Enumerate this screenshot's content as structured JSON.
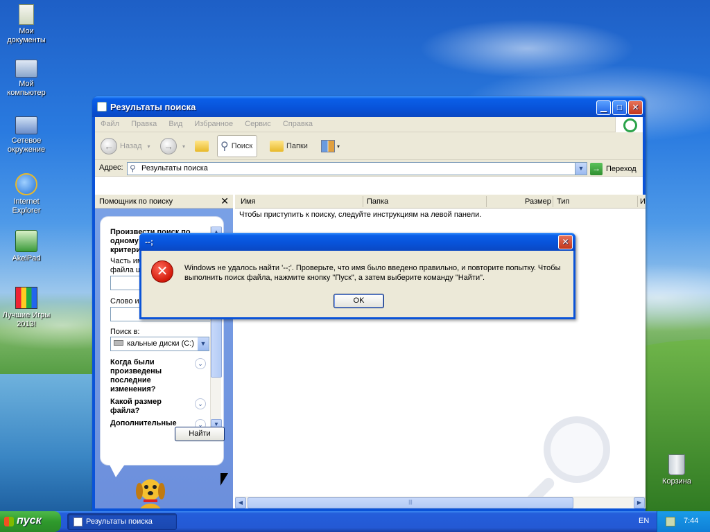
{
  "desktop": {
    "icons": [
      {
        "label_line1": "Мои",
        "label_line2": "документы",
        "icon": "my-documents-icon"
      },
      {
        "label_line1": "Мой",
        "label_line2": "компьютер",
        "icon": "my-computer-icon"
      },
      {
        "label_line1": "Сетевое",
        "label_line2": "окружение",
        "icon": "network-places-icon"
      },
      {
        "label_line1": "Internet",
        "label_line2": "Explorer",
        "icon": "internet-explorer-icon"
      },
      {
        "label_line1": "AkelPad",
        "label_line2": "",
        "icon": "akelpad-icon"
      },
      {
        "label_line1": "Лучшие Игры",
        "label_line2": "2013!",
        "icon": "games-icon"
      },
      {
        "label_line1": "Корзина",
        "label_line2": "",
        "icon": "recycle-bin-icon"
      }
    ]
  },
  "window": {
    "title": "Результаты поиска",
    "menu": [
      "Файл",
      "Правка",
      "Вид",
      "Избранное",
      "Сервис",
      "Справка"
    ],
    "toolbar": {
      "back_label": "Назад",
      "search_label": "Поиск",
      "folders_label": "Папки"
    },
    "address": {
      "label": "Адрес:",
      "value": "Результаты поиска",
      "go_label": "Переход"
    }
  },
  "search_pane": {
    "header": "Помощник по поиску",
    "close_glyph": "✕",
    "question": "Произвести поиск по одному или всем критериям.",
    "question_lines": [
      "Произвести поиск по",
      "одному или всем",
      "критериям."
    ],
    "part_name_label_1": "Часть им",
    "part_name_label_2": "файла це",
    "word_label": "Слово ил",
    "search_in_label": "Поиск в:",
    "search_in_value": "кальные диски (C:)",
    "when_lines": [
      "Когда были",
      "произведены",
      "последние",
      "изменения?"
    ],
    "size_lines": [
      "Какой размер",
      "файла?"
    ],
    "advanced_label": "Дополнительные",
    "find_button": "Найти"
  },
  "results": {
    "columns": [
      "Имя",
      "Папка",
      "Размер",
      "Тип",
      "И"
    ],
    "hint": "Чтобы приступить к поиску, следуйте инструкциям на левой панели."
  },
  "dialog": {
    "title": "--;",
    "message": "Windows не удалось найти '--;'. Проверьте, что имя было введено правильно, и повторите попытку. Чтобы выполнить поиск файла, нажмите кнопку \"Пуск\", а затем выберите команду \"Найти\".",
    "ok_label": "OK"
  },
  "taskbar": {
    "start_label": "пуск",
    "task_label": "Результаты поиска",
    "language": "EN",
    "clock": "7:44"
  },
  "colors": {
    "xp_blue": "#0a53d8",
    "start_green": "#2f9a2c",
    "dialog_face": "#ece9d8",
    "error_red": "#d21a0a"
  }
}
